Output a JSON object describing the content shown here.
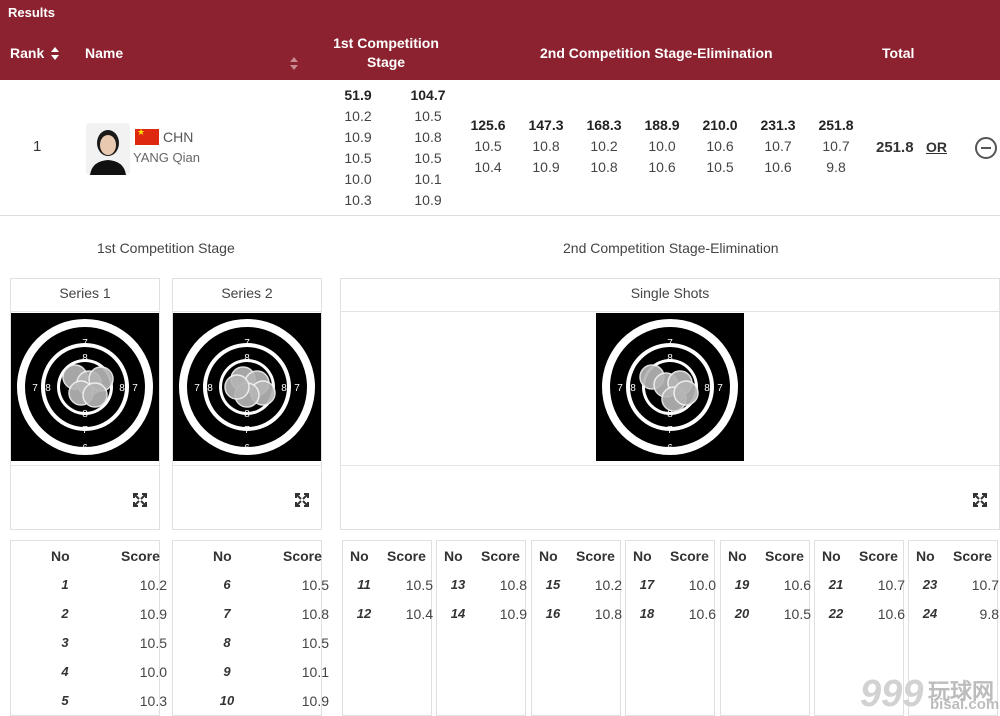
{
  "header": {
    "results": "Results",
    "rank": "Rank",
    "name": "Name",
    "stage1_line1": "1st Competition",
    "stage1_line2": "Stage",
    "stage2": "2nd Competition Stage-Elimination",
    "total": "Total"
  },
  "athlete": {
    "rank": "1",
    "noc": "CHN",
    "name": "YANG Qian",
    "stage1_subtotals": [
      "51.9",
      "104.7"
    ],
    "series1_shots": [
      "10.2",
      "10.9",
      "10.5",
      "10.0",
      "10.3"
    ],
    "series2_shots": [
      "10.5",
      "10.8",
      "10.5",
      "10.1",
      "10.9"
    ],
    "stage2_cumulative": [
      "125.6",
      "147.3",
      "168.3",
      "188.9",
      "210.0",
      "231.3",
      "251.8"
    ],
    "stage2_shot_a": [
      "10.5",
      "10.8",
      "10.2",
      "10.0",
      "10.6",
      "10.7",
      "10.7"
    ],
    "stage2_shot_b": [
      "10.4",
      "10.9",
      "10.8",
      "10.6",
      "10.5",
      "10.6",
      "9.8"
    ],
    "total": "251.8",
    "record": "OR"
  },
  "detail": {
    "stage1_title": "1st Competition Stage",
    "stage2_title": "2nd Competition Stage-Elimination",
    "series1_title": "Series 1",
    "series2_title": "Series 2",
    "single_shots_title": "Single Shots",
    "ring_labels": [
      "6",
      "7",
      "8"
    ]
  },
  "tables": {
    "no_label": "No",
    "score_label": "Score",
    "series1": [
      {
        "no": "1",
        "score": "10.2"
      },
      {
        "no": "2",
        "score": "10.9"
      },
      {
        "no": "3",
        "score": "10.5"
      },
      {
        "no": "4",
        "score": "10.0"
      },
      {
        "no": "5",
        "score": "10.3"
      }
    ],
    "series2": [
      {
        "no": "6",
        "score": "10.5"
      },
      {
        "no": "7",
        "score": "10.8"
      },
      {
        "no": "8",
        "score": "10.5"
      },
      {
        "no": "9",
        "score": "10.1"
      },
      {
        "no": "10",
        "score": "10.9"
      }
    ],
    "pairs": [
      [
        {
          "no": "11",
          "score": "10.5"
        },
        {
          "no": "12",
          "score": "10.4"
        }
      ],
      [
        {
          "no": "13",
          "score": "10.8"
        },
        {
          "no": "14",
          "score": "10.9"
        }
      ],
      [
        {
          "no": "15",
          "score": "10.2"
        },
        {
          "no": "16",
          "score": "10.8"
        }
      ],
      [
        {
          "no": "17",
          "score": "10.0"
        },
        {
          "no": "18",
          "score": "10.6"
        }
      ],
      [
        {
          "no": "19",
          "score": "10.6"
        },
        {
          "no": "20",
          "score": "10.5"
        }
      ],
      [
        {
          "no": "21",
          "score": "10.7"
        },
        {
          "no": "22",
          "score": "10.6"
        }
      ],
      [
        {
          "no": "23",
          "score": "10.7"
        },
        {
          "no": "24",
          "score": "9.8"
        }
      ]
    ]
  },
  "watermark": {
    "big": "999",
    "cn": "玩球网",
    "domain": "bisai.com"
  }
}
